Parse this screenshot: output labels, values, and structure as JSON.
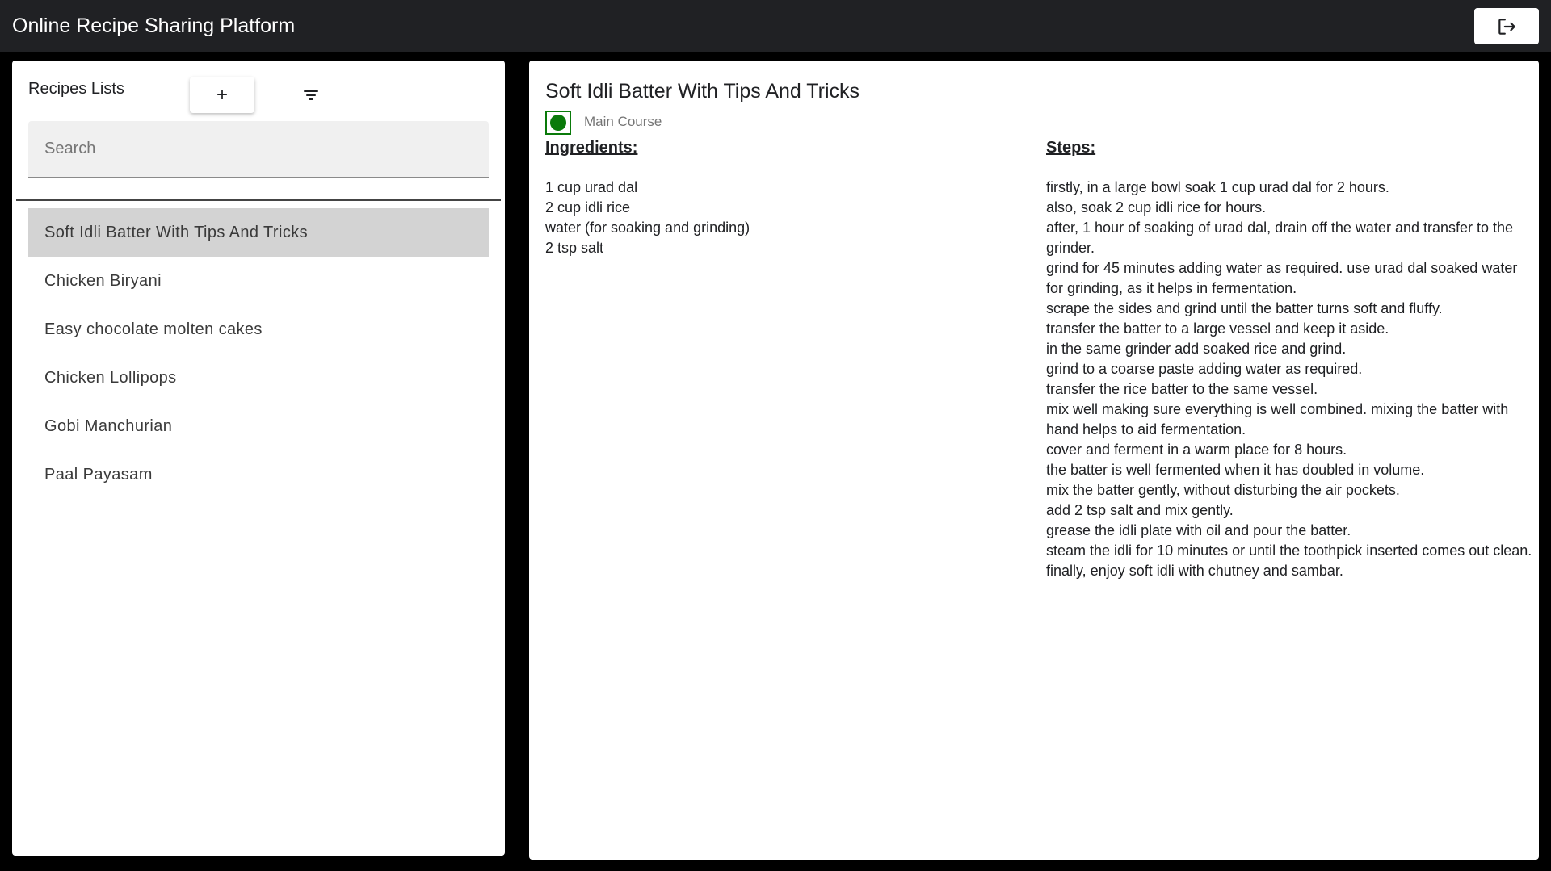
{
  "app": {
    "title": "Online Recipe Sharing Platform"
  },
  "header": {
    "logout_icon": "logout-icon"
  },
  "sidebar": {
    "title": "Recipes Lists",
    "add_label": "+",
    "filter_icon": "filter-icon",
    "search": {
      "placeholder": "Search",
      "value": ""
    },
    "recipes": [
      "Soft Idli Batter With Tips And Tricks",
      "Chicken Biryani",
      "Easy chocolate molten cakes",
      "Chicken Lollipops",
      "Gobi Manchurian",
      "Paal Payasam"
    ],
    "selected_index": 0
  },
  "recipe": {
    "title": "Soft Idli Batter With Tips And Tricks",
    "category": "Main Course",
    "diet_mark_color": "#0a7a0a",
    "ingredients_heading": "Ingredients:",
    "ingredients": [
      "1 cup urad dal",
      "2 cup idli rice",
      "water (for soaking and grinding)",
      "2 tsp salt"
    ],
    "steps_heading": "Steps:",
    "steps": [
      "firstly, in a large bowl soak 1 cup urad dal for 2 hours.",
      "also, soak 2 cup idli rice for hours.",
      "after, 1 hour of soaking of urad dal, drain off the water and transfer to the grinder.",
      "grind for 45 minutes adding water as required. use urad dal soaked water for grinding, as it helps in fermentation.",
      "scrape the sides and grind until the batter turns soft and fluffy.",
      "transfer the batter to a large vessel and keep it aside.",
      "in the same grinder add soaked rice and grind.",
      "grind to a coarse paste adding water as required.",
      "transfer the rice batter to the same vessel.",
      "mix well making sure everything is well combined. mixing the batter with hand helps to aid fermentation.",
      "cover and ferment in a warm place for 8 hours.",
      "the batter is well fermented when it has doubled in volume.",
      "mix the batter gently, without disturbing the air pockets.",
      "add 2 tsp salt and mix gently.",
      "grease the idli plate with oil and pour the batter.",
      "steam the idli for 10 minutes or until the toothpick inserted comes out clean.",
      "finally, enjoy soft idli with chutney and sambar."
    ]
  }
}
